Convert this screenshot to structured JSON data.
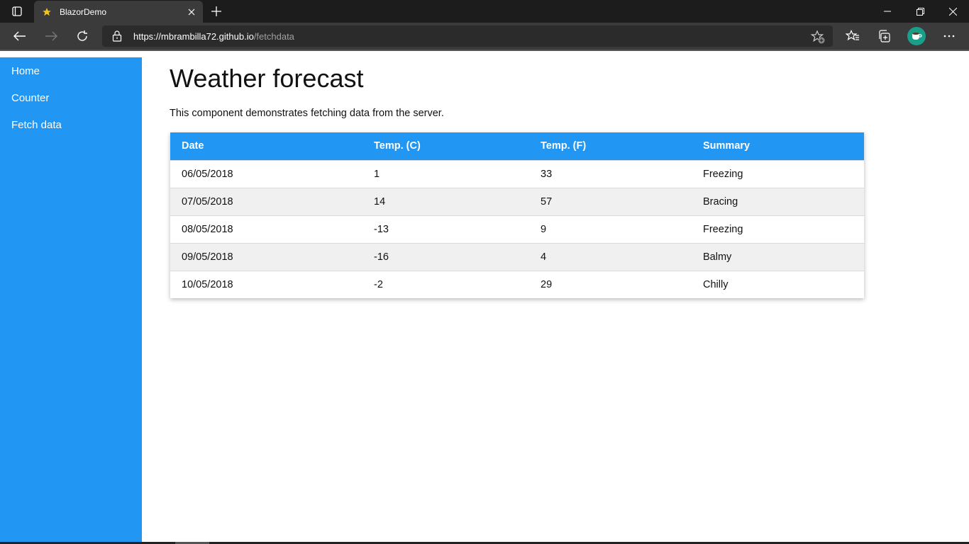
{
  "browser": {
    "tab": {
      "title": "BlazorDemo",
      "favicon": "star-icon"
    },
    "url": {
      "host": "https://mbrambilla72.github.io",
      "path": "/fetchdata"
    },
    "accent": "#2196f3"
  },
  "sidebar": {
    "items": [
      {
        "label": "Home"
      },
      {
        "label": "Counter"
      },
      {
        "label": "Fetch data"
      }
    ]
  },
  "page": {
    "title": "Weather forecast",
    "description": "This component demonstrates fetching data from the server."
  },
  "table": {
    "headers": [
      "Date",
      "Temp. (C)",
      "Temp. (F)",
      "Summary"
    ],
    "rows": [
      [
        "06/05/2018",
        "1",
        "33",
        "Freezing"
      ],
      [
        "07/05/2018",
        "14",
        "57",
        "Bracing"
      ],
      [
        "08/05/2018",
        "-13",
        "9",
        "Freezing"
      ],
      [
        "09/05/2018",
        "-16",
        "4",
        "Balmy"
      ],
      [
        "10/05/2018",
        "-2",
        "29",
        "Chilly"
      ]
    ]
  }
}
